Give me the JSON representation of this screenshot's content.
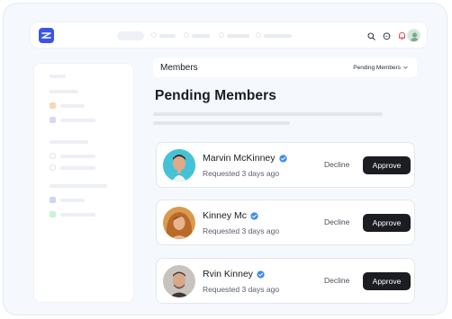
{
  "header": {
    "title": "Members",
    "filter_label": "Pending Members"
  },
  "page": {
    "title": "Pending Members"
  },
  "members": [
    {
      "name": "Marvin McKinney",
      "status": "Requested 3 days ago",
      "decline_label": "Decline",
      "approve_label": "Approve",
      "verified": true
    },
    {
      "name": "Kinney Mc",
      "status": "Requested 3 days ago",
      "decline_label": "Decline",
      "approve_label": "Approve",
      "verified": true
    },
    {
      "name": "Rvin Kinney",
      "status": "Requested 3 days ago",
      "decline_label": "Decline",
      "approve_label": "Approve",
      "verified": true
    }
  ],
  "colors": {
    "accent": "#3a55e6",
    "verified": "#3d8bf5",
    "approve_bg": "#1b1d22",
    "notification": "#e5484d"
  },
  "icons": {
    "logo": "app-logo-icon",
    "search": "search-icon",
    "chat": "chat-icon",
    "bell": "bell-icon",
    "filter_caret": "chevron-down-icon",
    "verified": "verified-badge-icon"
  }
}
